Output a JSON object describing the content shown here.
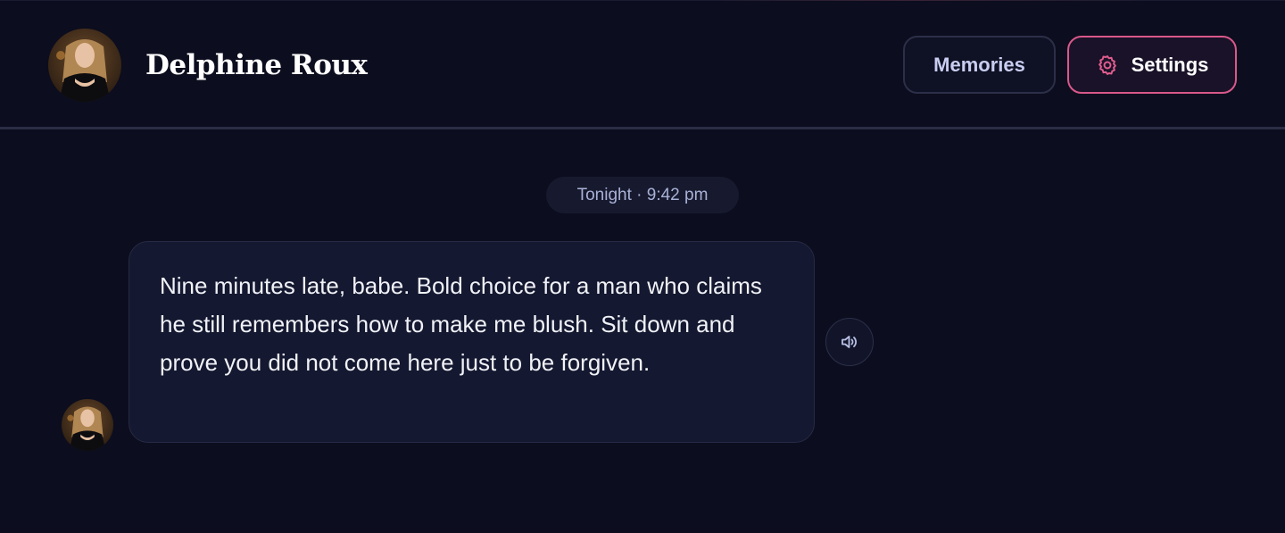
{
  "header": {
    "character_name": "Delphine Roux",
    "memories_label": "Memories",
    "settings_label": "Settings"
  },
  "chat": {
    "timestamp": "Tonight · 9:42 pm",
    "messages": [
      {
        "sender": "Delphine Roux",
        "text": "Nine minutes late, babe. Bold choice for a man who claims he still remembers how to make me blush. Sit down and prove you did not come here just to be forgiven."
      }
    ]
  },
  "colors": {
    "background": "#0c0d1e",
    "accent": "#d9588a",
    "bubble": "#141830"
  },
  "icons": {
    "settings": "gear-icon",
    "audio": "speaker-icon"
  }
}
